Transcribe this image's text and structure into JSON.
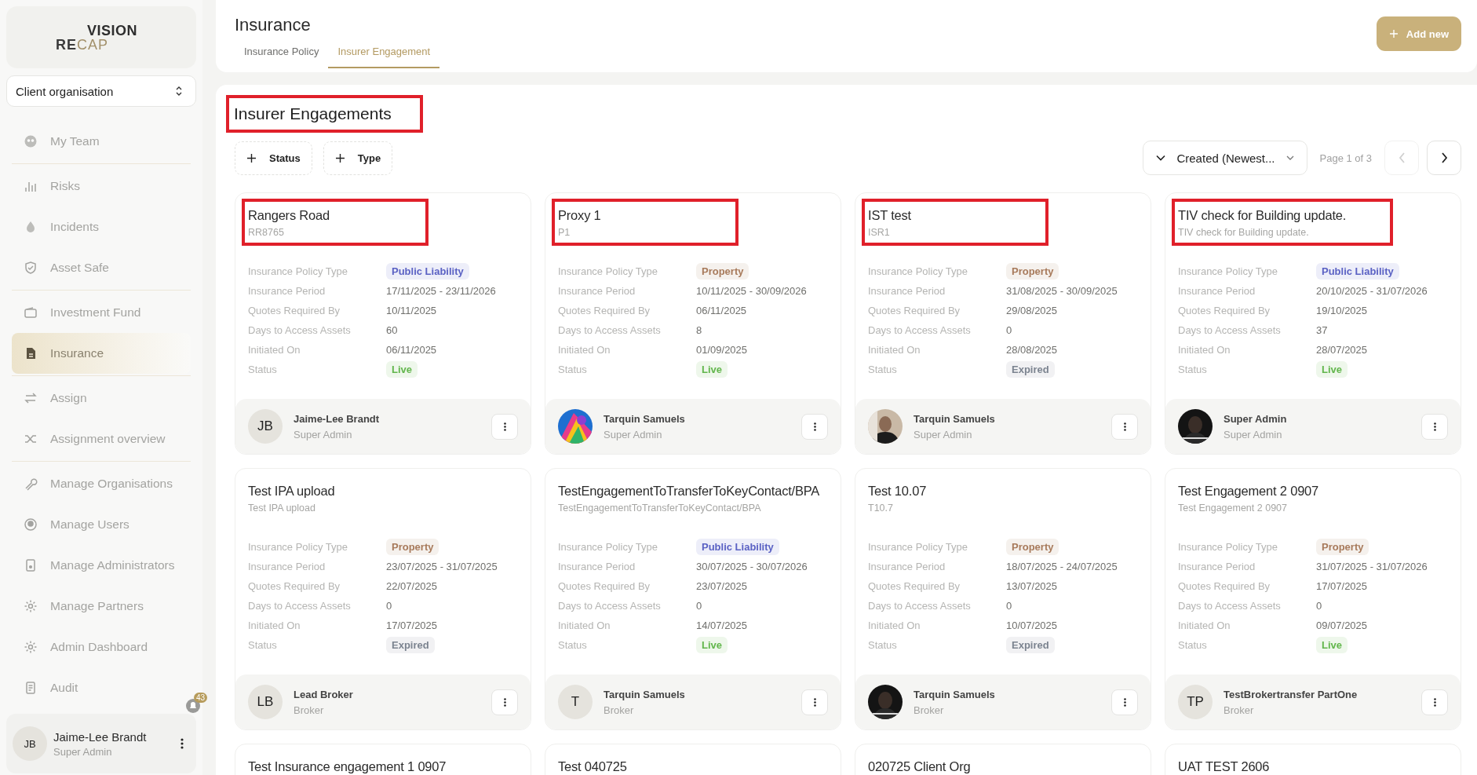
{
  "sidebar": {
    "logo": {
      "line_1": "VISION",
      "line_2_dark": "RE",
      "line_2_light": "CAP"
    },
    "organisation_select": {
      "value": "Client organisation"
    },
    "groups": [
      [
        {
          "label": "My Team",
          "selected": false
        }
      ],
      [
        {
          "label": "Risks",
          "selected": false
        },
        {
          "label": "Incidents",
          "selected": false
        },
        {
          "label": "Asset Safe",
          "selected": false
        }
      ],
      [
        {
          "label": "Investment Fund",
          "selected": false
        },
        {
          "label": "Insurance",
          "selected": true
        }
      ],
      [
        {
          "label": "Assign",
          "selected": false
        },
        {
          "label": "Assignment overview",
          "selected": false
        }
      ],
      [
        {
          "label": "Manage Organisations",
          "selected": false
        },
        {
          "label": "Manage Users",
          "selected": false
        },
        {
          "label": "Manage Administrators",
          "selected": false
        },
        {
          "label": "Manage Partners",
          "selected": false
        },
        {
          "label": "Admin Dashboard",
          "selected": false
        },
        {
          "label": "Audit",
          "selected": false
        }
      ]
    ],
    "user": {
      "initials": "JB",
      "name": "Jaime-Lee Brandt",
      "role": "Super Admin",
      "notification_count": "43"
    }
  },
  "header": {
    "title": "Insurance",
    "tabs": [
      {
        "label": "Insurance Policy",
        "selected": false
      },
      {
        "label": "Insurer Engagement",
        "selected": true
      }
    ],
    "add_button": "Add new"
  },
  "section": {
    "heading": "Insurer Engagements",
    "highlighted": true,
    "filters": [
      "Status",
      "Type"
    ],
    "sort": "Created (Newest...",
    "page_label": "Page 1 of 3",
    "pager": [
      {
        "kind": "prev",
        "disabled": true
      },
      {
        "kind": "next",
        "disabled": false
      }
    ]
  },
  "cards": [
    {
      "title": "Rangers Road",
      "subtitle": "RR8765",
      "highlighted": true,
      "fields": [
        {
          "label": "Insurance Policy Type",
          "value": "Public Liability",
          "color": "#5b62c4"
        },
        {
          "label": "Insurance Period",
          "value": "17/11/2025 - 23/11/2026"
        },
        {
          "label": "Quotes Required By",
          "value": "10/11/2025"
        },
        {
          "label": "Days to Access Assets",
          "value": "60"
        },
        {
          "label": "Initiated On",
          "value": "06/11/2025"
        },
        {
          "label": "Status",
          "value": "Live",
          "color": "#62b64c"
        }
      ],
      "contact": {
        "avatar": {
          "kind": "initials",
          "initials": "JB"
        },
        "name": "Jaime-Lee Brandt",
        "role": "Super Admin"
      }
    },
    {
      "title": "Proxy 1",
      "subtitle": "P1",
      "highlighted": true,
      "fields": [
        {
          "label": "Insurance Policy Type",
          "value": "Property",
          "color": "#a87b5c"
        },
        {
          "label": "Insurance Period",
          "value": "10/11/2025 - 30/09/2026"
        },
        {
          "label": "Quotes Required By",
          "value": "06/11/2025"
        },
        {
          "label": "Days to Access Assets",
          "value": "8"
        },
        {
          "label": "Initiated On",
          "value": "01/09/2025"
        },
        {
          "label": "Status",
          "value": "Live",
          "color": "#62b64c"
        }
      ],
      "contact": {
        "name": "Tarquin Samuels",
        "role": "Super Admin"
      }
    },
    {
      "title": "IST test",
      "subtitle": "ISR1",
      "highlighted": true,
      "fields": [
        {
          "label": "Insurance Policy Type",
          "value": "Property",
          "color": "#a87b5c"
        },
        {
          "label": "Insurance Period",
          "value": "31/08/2025 - 30/09/2025"
        },
        {
          "label": "Quotes Required By",
          "value": "29/08/2025"
        },
        {
          "label": "Days to Access Assets",
          "value": "0"
        },
        {
          "label": "Initiated On",
          "value": "28/08/2025"
        },
        {
          "label": "Status",
          "value": "Expired",
          "color": "#7c8490"
        }
      ],
      "contact": {
        "name": "Tarquin Samuels",
        "role": "Super Admin"
      }
    },
    {
      "title": "TIV check for Building update.",
      "subtitle": "TIV check for Building update.",
      "highlighted": true,
      "fields": [
        {
          "label": "Insurance Policy Type",
          "value": "Public Liability",
          "color": "#5b62c4"
        },
        {
          "label": "Insurance Period",
          "value": "20/10/2025 - 31/07/2026"
        },
        {
          "label": "Quotes Required By",
          "value": "19/10/2025"
        },
        {
          "label": "Days to Access Assets",
          "value": "37"
        },
        {
          "label": "Initiated On",
          "value": "28/07/2025"
        },
        {
          "label": "Status",
          "value": "Live",
          "color": "#62b64c"
        }
      ],
      "contact": {
        "name": "Super Admin",
        "role": "Super Admin"
      }
    },
    {
      "title": "Test IPA upload",
      "subtitle": "Test IPA upload",
      "highlighted": false,
      "fields": [
        {
          "label": "Insurance Policy Type",
          "value": "Property",
          "color": "#a87b5c"
        },
        {
          "label": "Insurance Period",
          "value": "23/07/2025 - 31/07/2025"
        },
        {
          "label": "Quotes Required By",
          "value": "22/07/2025"
        },
        {
          "label": "Days to Access Assets",
          "value": "0"
        },
        {
          "label": "Initiated On",
          "value": "17/07/2025"
        },
        {
          "label": "Status",
          "value": "Expired",
          "color": "#7c8490"
        }
      ],
      "contact": {
        "avatar": {
          "kind": "initials",
          "initials": "LB"
        },
        "name": "Lead Broker",
        "role": "Broker"
      }
    },
    {
      "title": "TestEngagementToTransferToKeyContact/BPA",
      "subtitle": "TestEngagementToTransferToKeyContact/BPA",
      "highlighted": false,
      "fields": [
        {
          "label": "Insurance Policy Type",
          "value": "Public Liability",
          "color": "#5b62c4"
        },
        {
          "label": "Insurance Period",
          "value": "30/07/2025 - 30/07/2026"
        },
        {
          "label": "Quotes Required By",
          "value": "23/07/2025"
        },
        {
          "label": "Days to Access Assets",
          "value": "0"
        },
        {
          "label": "Initiated On",
          "value": "14/07/2025"
        },
        {
          "label": "Status",
          "value": "Live",
          "color": "#62b64c"
        }
      ],
      "contact": {
        "avatar": {
          "kind": "initials",
          "initials": "T"
        },
        "name": "Tarquin Samuels",
        "role": "Broker"
      }
    },
    {
      "title": "Test 10.07",
      "subtitle": "T10.7",
      "highlighted": false,
      "fields": [
        {
          "label": "Insurance Policy Type",
          "value": "Property",
          "color": "#a87b5c"
        },
        {
          "label": "Insurance Period",
          "value": "18/07/2025 - 24/07/2025"
        },
        {
          "label": "Quotes Required By",
          "value": "13/07/2025"
        },
        {
          "label": "Days to Access Assets",
          "value": "0"
        },
        {
          "label": "Initiated On",
          "value": "10/07/2025"
        },
        {
          "label": "Status",
          "value": "Expired",
          "color": "#7c8490"
        }
      ],
      "contact": {
        "name": "Tarquin Samuels",
        "role": "Broker"
      }
    },
    {
      "title": "Test Engagement 2 0907",
      "subtitle": "Test Engagement 2 0907",
      "highlighted": false,
      "fields": [
        {
          "label": "Insurance Policy Type",
          "value": "Property",
          "color": "#a87b5c"
        },
        {
          "label": "Insurance Period",
          "value": "31/07/2025 - 31/07/2026"
        },
        {
          "label": "Quotes Required By",
          "value": "17/07/2025"
        },
        {
          "label": "Days to Access Assets",
          "value": "0"
        },
        {
          "label": "Initiated On",
          "value": "09/07/2025"
        },
        {
          "label": "Status",
          "value": "Live",
          "color": "#62b64c"
        }
      ],
      "contact": {
        "avatar": {
          "kind": "initials",
          "initials": "TP"
        },
        "name": "TestBrokertransfer PartOne",
        "role": "Broker"
      }
    },
    {
      "title": "Test Insurance engagement 1 0907",
      "highlighted": false
    },
    {
      "title": "Test 040725",
      "highlighted": false
    },
    {
      "title": "020725 Client Org",
      "highlighted": false
    },
    {
      "title": "UAT TEST 2606",
      "highlighted": false
    }
  ]
}
